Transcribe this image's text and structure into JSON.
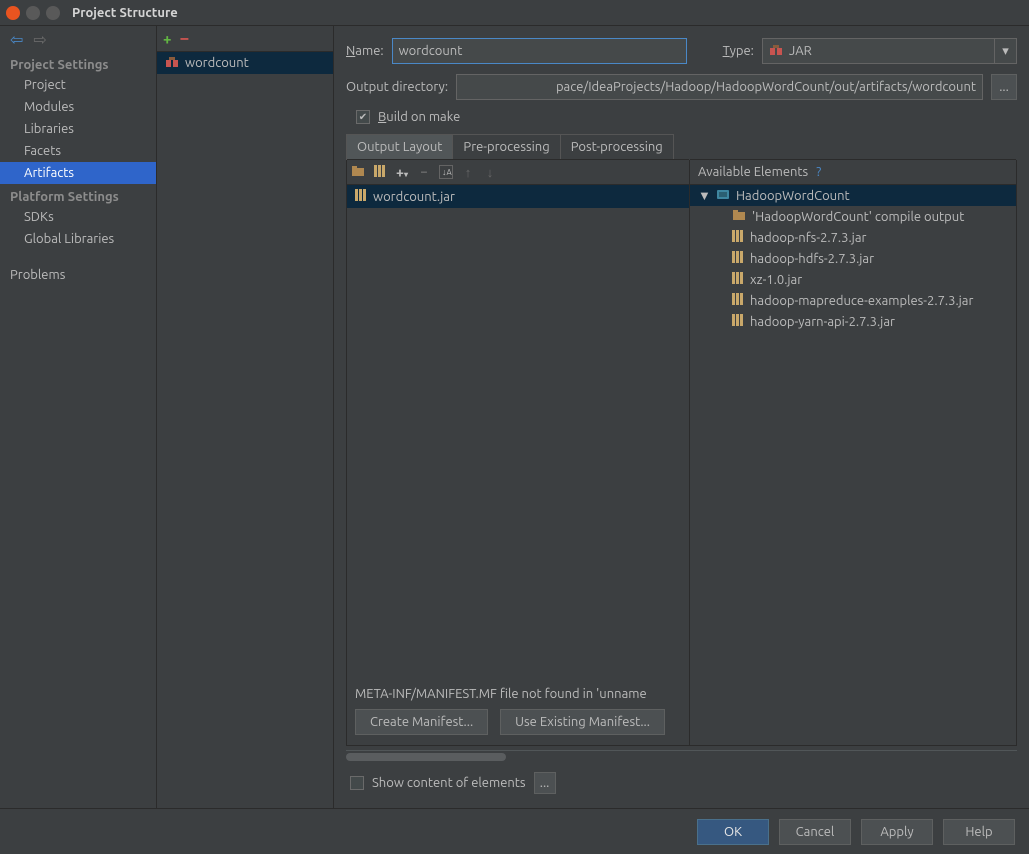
{
  "window": {
    "title": "Project Structure"
  },
  "sidebar": {
    "section1": "Project Settings",
    "items1": [
      "Project",
      "Modules",
      "Libraries",
      "Facets",
      "Artifacts"
    ],
    "section2": "Platform Settings",
    "items2": [
      "SDKs",
      "Global Libraries"
    ],
    "problems": "Problems"
  },
  "midlist": {
    "item0": "wordcount"
  },
  "form": {
    "name_label": "Name:",
    "name_value": "wordcount",
    "type_label": "Type:",
    "type_value": "JAR",
    "outdir_label": "Output directory:",
    "outdir_value": "pace/IdeaProjects/Hadoop/HadoopWordCount/out/artifacts/wordcount",
    "build_label": "Build on make",
    "browse": "..."
  },
  "tabs": {
    "t0": "Output Layout",
    "t1": "Pre-processing",
    "t2": "Post-processing"
  },
  "layout": {
    "jaritem": "wordcount.jar",
    "warning": "META-INF/MANIFEST.MF file not found in 'unname",
    "create_btn": "Create Manifest...",
    "use_btn": "Use Existing Manifest..."
  },
  "available": {
    "header": "Available Elements",
    "help": "?",
    "root": "HadoopWordCount",
    "children": [
      "'HadoopWordCount' compile output",
      "hadoop-nfs-2.7.3.jar",
      "hadoop-hdfs-2.7.3.jar",
      "xz-1.0.jar",
      "hadoop-mapreduce-examples-2.7.3.jar",
      "hadoop-yarn-api-2.7.3.jar"
    ]
  },
  "showcontent": {
    "label": "Show content of elements",
    "dots": "..."
  },
  "footer": {
    "ok": "OK",
    "cancel": "Cancel",
    "apply": "Apply",
    "help": "Help"
  }
}
